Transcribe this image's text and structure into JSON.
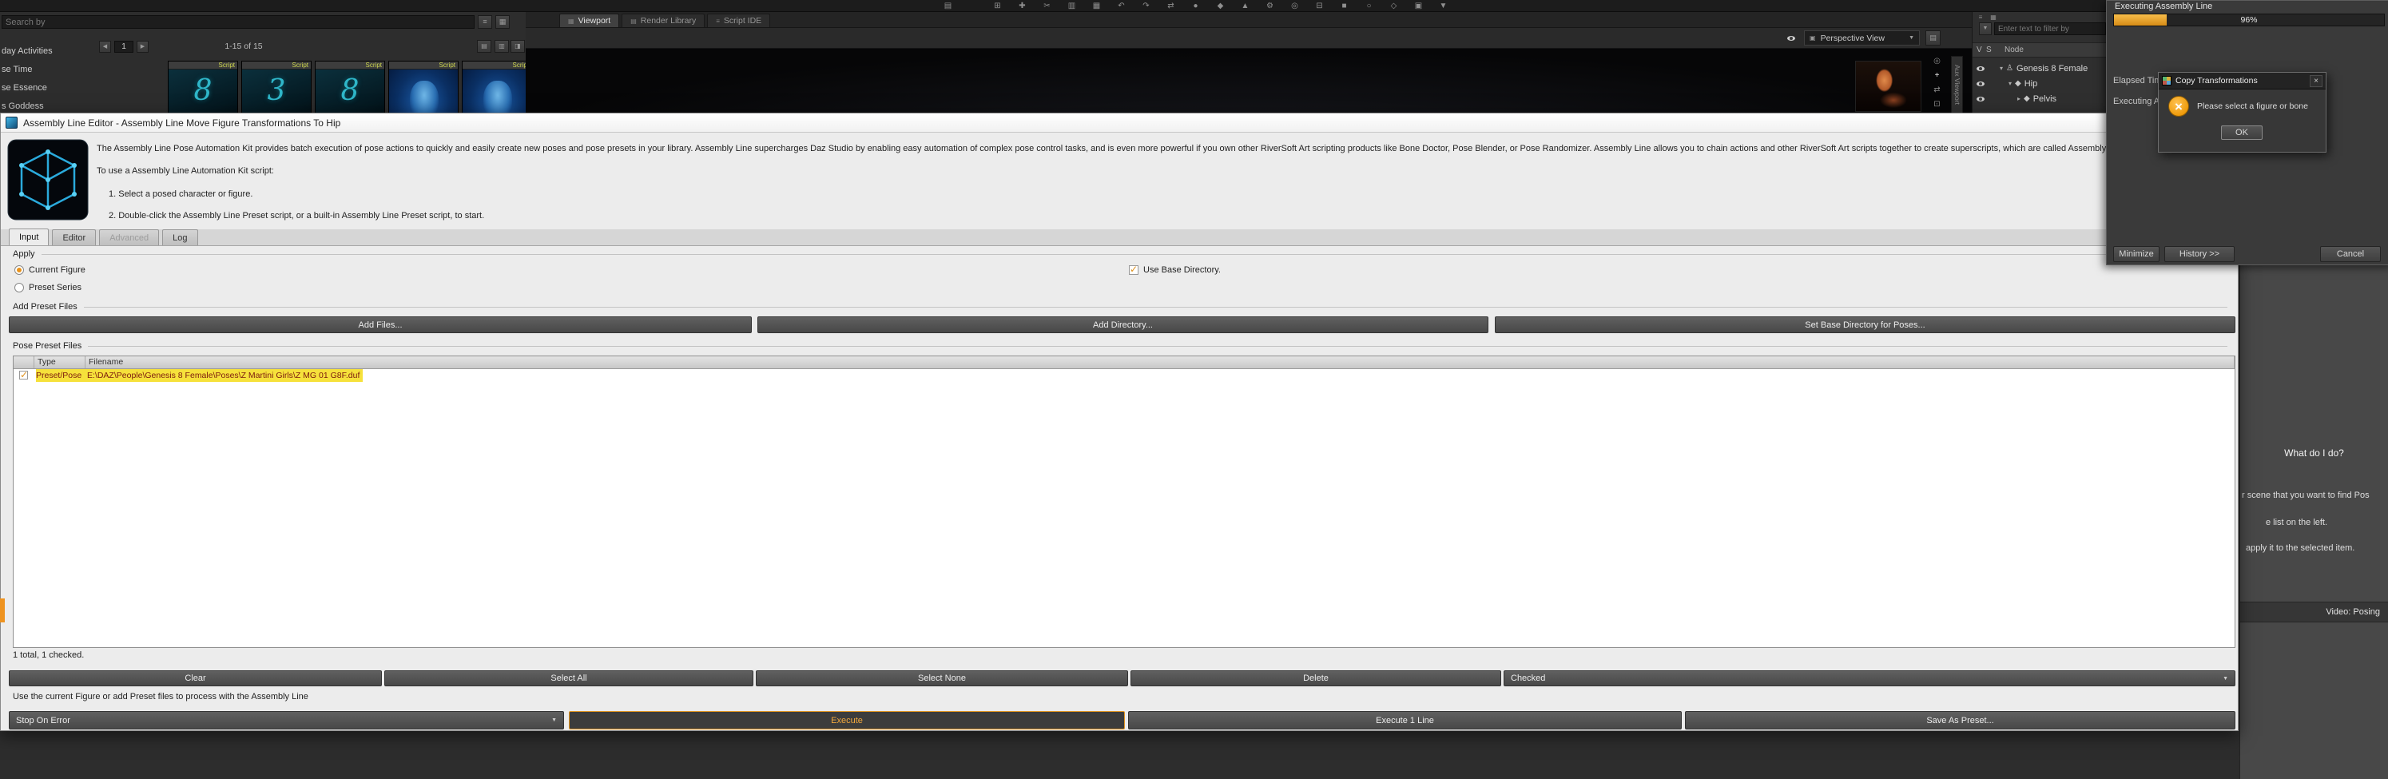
{
  "glyphs": {
    "dropdown": "▼",
    "close": "×",
    "prev": "◀",
    "next": "▶"
  },
  "menubar": {
    "icons": [
      {
        "glyph": "▤"
      },
      {
        "glyph": "⊞"
      },
      {
        "glyph": "✚"
      },
      {
        "glyph": "✂"
      },
      {
        "glyph": "▥"
      },
      {
        "glyph": "▦"
      },
      {
        "glyph": "↶"
      },
      {
        "glyph": "↷"
      },
      {
        "glyph": "⇄"
      },
      {
        "glyph": "●"
      },
      {
        "glyph": "◆"
      },
      {
        "glyph": "▲"
      },
      {
        "glyph": "⚙"
      },
      {
        "glyph": "◎"
      },
      {
        "glyph": "⊟"
      },
      {
        "glyph": "■"
      },
      {
        "glyph": "○"
      },
      {
        "glyph": "◇"
      },
      {
        "glyph": "▣"
      },
      {
        "glyph": "▼"
      }
    ]
  },
  "left_panel": {
    "search_placeholder": "Search by",
    "view_buttons": [
      {
        "glyph": "≡"
      },
      {
        "glyph": "▦"
      }
    ],
    "pager": {
      "page": "1",
      "range": "1-15 of 15"
    },
    "sort_buttons": [
      {
        "glyph": "▤"
      },
      {
        "glyph": "▥"
      },
      {
        "glyph": "◨"
      }
    ],
    "folders": [
      "day Activities",
      "se Time",
      "se Essence",
      "s Goddess"
    ],
    "thumbnails": [
      {
        "badge": "Script",
        "glyph": "8"
      },
      {
        "badge": "Script",
        "glyph": "3"
      },
      {
        "badge": "Script",
        "glyph": "8"
      },
      {
        "badge": "Script",
        "glyph": ""
      },
      {
        "badge": "Script",
        "glyph": ""
      }
    ]
  },
  "viewport": {
    "tabs": [
      {
        "glyph": "▦",
        "label": "Viewport"
      },
      {
        "glyph": "▤",
        "label": "Render Library"
      },
      {
        "glyph": "≡",
        "label": "Script IDE"
      }
    ],
    "camera_label": "Perspective View",
    "camera_icon": "▣",
    "pane_icon": "▤",
    "side_tab_label": "Aux Viewport",
    "nav_icons": [
      {
        "glyph": "◎"
      },
      {
        "glyph": "+"
      },
      {
        "glyph": "⇄"
      },
      {
        "glyph": "⊡"
      }
    ]
  },
  "scene_panel": {
    "tab_icons": [
      {
        "glyph": "≡"
      },
      {
        "glyph": "▦"
      }
    ],
    "filter_placeholder": "Enter text to filter by",
    "filter_icon": "▼",
    "header": {
      "v": "V",
      "s": "S",
      "node": "Node"
    },
    "nodes": [
      {
        "arrow": "▾",
        "icon": "♙",
        "label": "Genesis 8 Female"
      },
      {
        "arrow": "▾",
        "icon": "◆",
        "label": "Hip"
      },
      {
        "arrow": "▸",
        "icon": "◆",
        "label": "Pelvis"
      }
    ]
  },
  "progress_dialog": {
    "title": "Executing Assembly Line",
    "percent": "96%",
    "elapsed_label": "Elapsed Time",
    "executing_label": "Executing As",
    "minimize": "Minimize",
    "history": "History >>",
    "cancel": "Cancel"
  },
  "message_dialog": {
    "title": "Copy Transformations",
    "message": "Please select a figure or bone",
    "ok": "OK"
  },
  "editor": {
    "title": "Assembly Line Editor - Assembly Line Move Figure Transformations To Hip",
    "description": "The Assembly Line Pose Automation Kit provides batch execution of pose actions to quickly and easily create new poses and pose presets in your library.  Assembly Line supercharges Daz Studio by enabling easy automation of complex pose control tasks, and is even more powerful if you own other RiverSoft Art scripting products like Bone Doctor, Pose Blender, or Pose Randomizer.  Assembly Line allows you to chain actions and other RiverSoft Art scripts together to create superscripts, which are called Assembly Lin",
    "usage_intro": "To use a Assembly Line Automation Kit script:",
    "steps": [
      "1. Select a posed character or figure.",
      "2. Double-click the Assembly Line Preset script, or a built-in Assembly Line Preset script, to start."
    ],
    "tabs": [
      {
        "label": "Input"
      },
      {
        "label": "Editor"
      },
      {
        "label": "Advanced"
      },
      {
        "label": "Log"
      }
    ],
    "apply_label": "Apply",
    "options": {
      "current": "Current Figure",
      "preset": "Preset Series",
      "current_selected": true
    },
    "use_base_dir": {
      "label": "Use Base Directory.",
      "checked": true
    },
    "add_group_label": "Add Preset Files",
    "add_buttons": [
      "Add Files...",
      "Add Directory...",
      "Set Base Directory for Poses..."
    ],
    "files_group_label": "Pose Preset Files",
    "table": {
      "columns": [
        "Type",
        "Filename"
      ],
      "rows": [
        {
          "checked": true,
          "type": "Preset/Pose",
          "filename": "E:\\DAZ\\People\\Genesis 8 Female\\Poses\\Z Martini Girls\\Z MG 01 G8F.duf"
        }
      ],
      "summary": "1 total, 1 checked."
    },
    "list_buttons": [
      "Clear",
      "Select All",
      "Select None",
      "Delete"
    ],
    "checked_dropdown": "Checked",
    "hint": "Use the current Figure or add Preset files to process with the Assembly Line",
    "stop_on_error": "Stop On Error",
    "execute": "Execute",
    "execute_line": "Execute 1 Line",
    "save_preset": "Save As Preset..."
  },
  "help_panel": {
    "title": "What do I do?",
    "lines": [
      "r scene that you want to find Pos",
      "e list on the left.",
      "apply it to the selected item."
    ],
    "video_label": "Video: Posing"
  }
}
